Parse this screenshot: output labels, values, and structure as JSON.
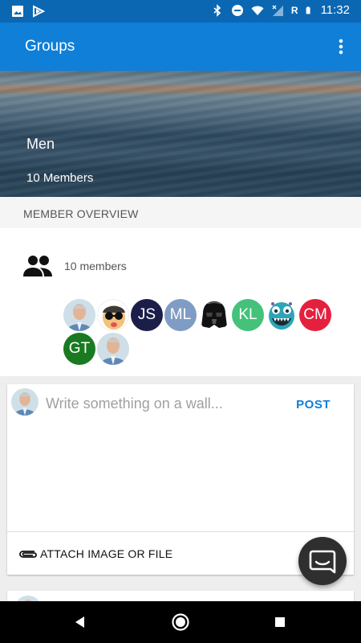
{
  "status_bar": {
    "time": "11:32",
    "network_letter": "R"
  },
  "app_bar": {
    "title": "Groups"
  },
  "group": {
    "name": "Men",
    "members_text": "10 Members"
  },
  "section": {
    "title": "MEMBER OVERVIEW"
  },
  "overview": {
    "members_count_text": "10 members",
    "avatars": [
      {
        "type": "photo",
        "label": "",
        "color": "#d9e6f1"
      },
      {
        "type": "cartoon",
        "label": "",
        "color": "#f0c060"
      },
      {
        "type": "initials",
        "label": "JS",
        "color": "#1c1e4a"
      },
      {
        "type": "initials",
        "label": "ML",
        "color": "#7f9cc4"
      },
      {
        "type": "vader",
        "label": "",
        "color": "#000000"
      },
      {
        "type": "initials",
        "label": "KL",
        "color": "#44c27a"
      },
      {
        "type": "monster",
        "label": "",
        "color": "#2ba5b8"
      },
      {
        "type": "initials",
        "label": "CM",
        "color": "#e5203f"
      },
      {
        "type": "initials",
        "label": "GT",
        "color": "#1a7a22"
      },
      {
        "type": "photo",
        "label": "",
        "color": "#d9e6f1"
      }
    ]
  },
  "composer": {
    "placeholder": "Write something on a wall...",
    "post_label": "POST",
    "attach_label": "ATTACH IMAGE OR FILE"
  },
  "colors": {
    "primary": "#0f7fd8",
    "status_bar": "#0b67b2"
  }
}
